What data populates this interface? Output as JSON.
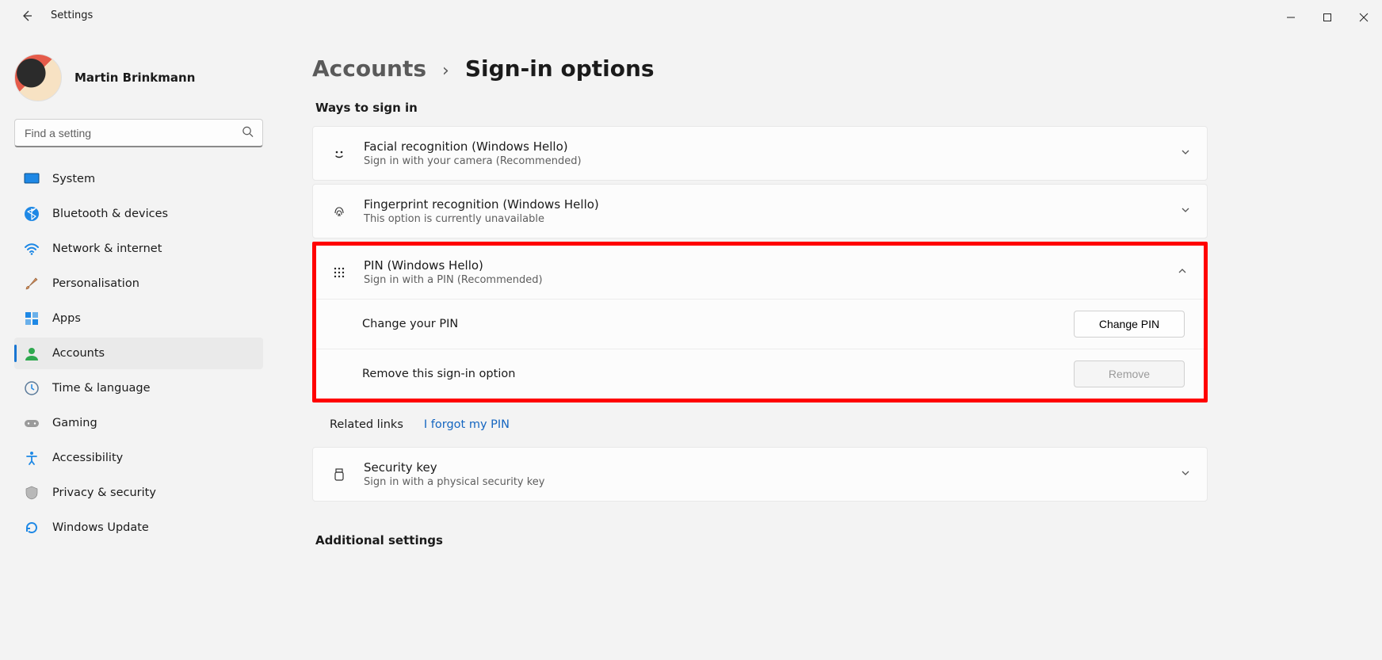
{
  "window": {
    "app_title": "Settings",
    "minimize_label": "Minimize",
    "maximize_label": "Maximize",
    "close_label": "Close"
  },
  "user": {
    "name": "Martin Brinkmann"
  },
  "search": {
    "placeholder": "Find a setting"
  },
  "nav": {
    "system": "System",
    "bluetooth": "Bluetooth & devices",
    "network": "Network & internet",
    "personalisation": "Personalisation",
    "apps": "Apps",
    "accounts": "Accounts",
    "time": "Time & language",
    "gaming": "Gaming",
    "accessibility": "Accessibility",
    "privacy": "Privacy & security",
    "update": "Windows Update"
  },
  "breadcrumb": {
    "top": "Accounts",
    "current": "Sign-in options"
  },
  "sections": {
    "ways": "Ways to sign in",
    "additional": "Additional settings"
  },
  "options": {
    "face": {
      "title": "Facial recognition (Windows Hello)",
      "sub": "Sign in with your camera (Recommended)"
    },
    "finger": {
      "title": "Fingerprint recognition (Windows Hello)",
      "sub": "This option is currently unavailable"
    },
    "pin": {
      "title": "PIN (Windows Hello)",
      "sub": "Sign in with a PIN (Recommended)",
      "change_label": "Change your PIN",
      "change_button": "Change PIN",
      "remove_label": "Remove this sign-in option",
      "remove_button": "Remove"
    },
    "securitykey": {
      "title": "Security key",
      "sub": "Sign in with a physical security key"
    }
  },
  "related": {
    "label": "Related links",
    "forgot": "I forgot my PIN"
  }
}
